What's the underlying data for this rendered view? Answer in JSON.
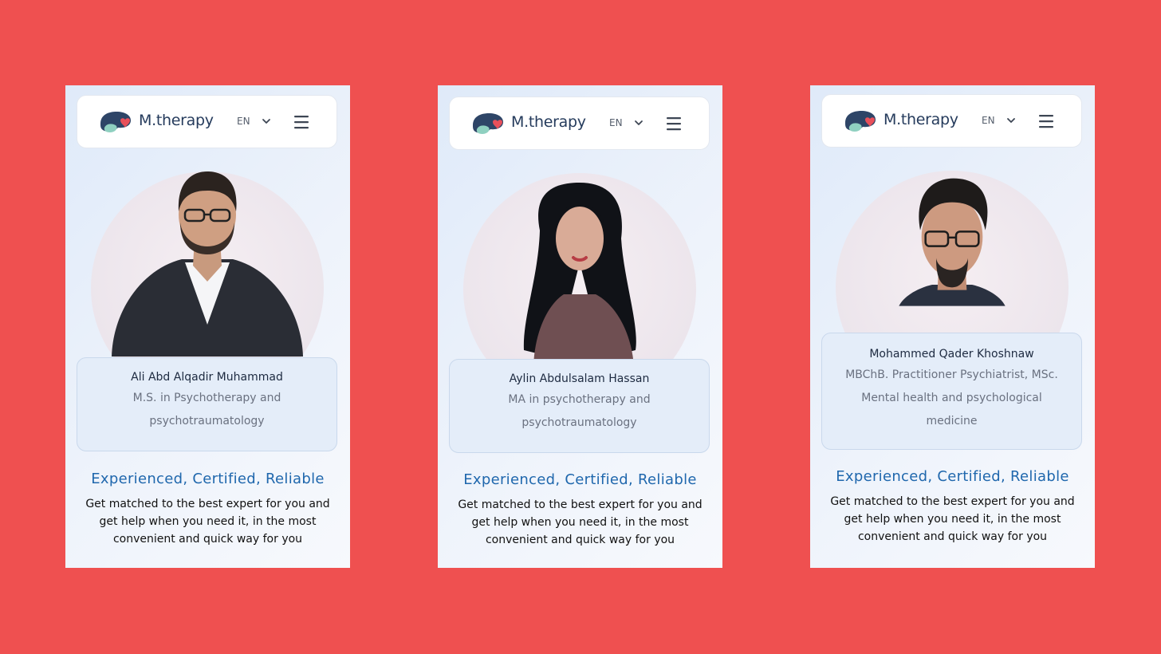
{
  "brand": {
    "name": "M.therapy",
    "logo_icon": "brain-heart-logo-icon"
  },
  "language": {
    "selected": "EN"
  },
  "colors": {
    "background": "#ef5050",
    "accent": "#1f67ad",
    "brand_dark": "#253b5c"
  },
  "cards": [
    {
      "name": "Ali Abd Alqadir Muhammad",
      "credentials": "M.S. in Psychotherapy and psychotraumatology",
      "tagline": "Experienced, Certified, Reliable",
      "description": "Get matched to the best expert for you and get help when you need it, in the most convenient and quick way for you"
    },
    {
      "name": "Aylin Abdulsalam Hassan",
      "credentials": "MA in psychotherapy and psychotraumatology",
      "tagline": "Experienced, Certified, Reliable",
      "description": "Get matched to the best expert for you and get help when you need it, in the most convenient and quick way for you"
    },
    {
      "name": "Mohammed Qader Khoshnaw",
      "credentials": "MBChB. Practitioner Psychiatrist, MSc. Mental health and psychological medicine",
      "tagline": "Experienced, Certified, Reliable",
      "description": "Get matched to the best expert for you and get help when you need it, in the most convenient and quick way for you"
    }
  ]
}
